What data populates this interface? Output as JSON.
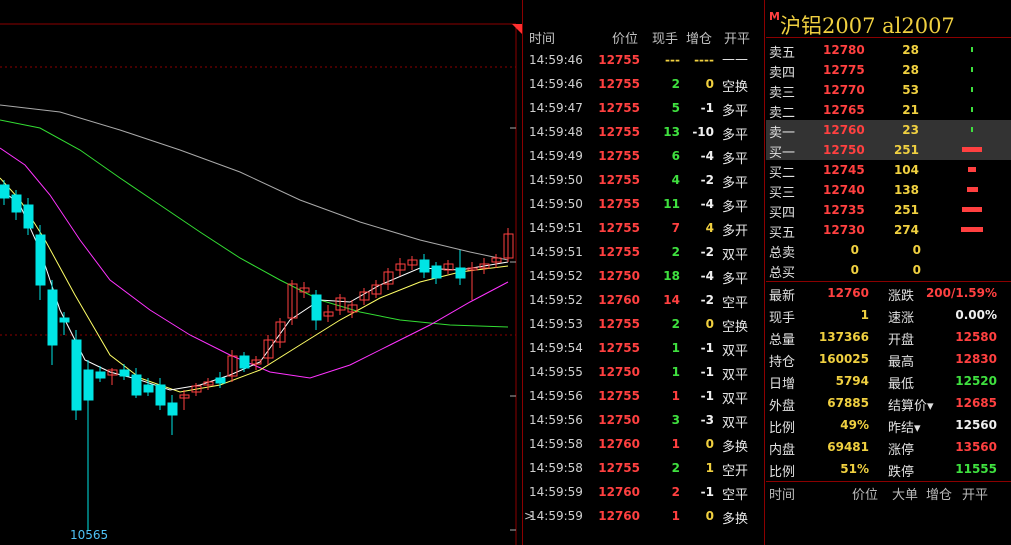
{
  "chart": {
    "low_label": "10565",
    "colors": {
      "up": "#ff4040",
      "down": "#00e5e5",
      "ma1": "#ffffff",
      "ma2": "#ffff66",
      "ma3": "#ff33ff",
      "ma4": "#33dd33",
      "ma5": "#aaaaaa"
    }
  },
  "trades": {
    "headers": {
      "time": "时间",
      "price": "价位",
      "vol": "现手",
      "oi": "增仓",
      "type": "开平"
    },
    "rows": [
      {
        "time": "14:59:46",
        "price": "12755",
        "vol": "---",
        "oi": "----",
        "type": "——"
      },
      {
        "time": "14:59:46",
        "price": "12755",
        "vol": "2",
        "oi": "0",
        "type": "空换"
      },
      {
        "time": "14:59:47",
        "price": "12755",
        "vol": "5",
        "oi": "-1",
        "type": "多平"
      },
      {
        "time": "14:59:48",
        "price": "12755",
        "vol": "13",
        "oi": "-10",
        "type": "多平"
      },
      {
        "time": "14:59:49",
        "price": "12755",
        "vol": "6",
        "oi": "-4",
        "type": "多平"
      },
      {
        "time": "14:59:50",
        "price": "12755",
        "vol": "4",
        "oi": "-2",
        "type": "多平"
      },
      {
        "time": "14:59:50",
        "price": "12755",
        "vol": "11",
        "oi": "-4",
        "type": "多平"
      },
      {
        "time": "14:59:51",
        "price": "12755",
        "vol": "7",
        "oi": "4",
        "type": "多开"
      },
      {
        "time": "14:59:51",
        "price": "12755",
        "vol": "2",
        "oi": "-2",
        "type": "双平"
      },
      {
        "time": "14:59:52",
        "price": "12750",
        "vol": "18",
        "oi": "-4",
        "type": "多平"
      },
      {
        "time": "14:59:52",
        "price": "12760",
        "vol": "14",
        "oi": "-2",
        "type": "空平"
      },
      {
        "time": "14:59:53",
        "price": "12755",
        "vol": "2",
        "oi": "0",
        "type": "空换"
      },
      {
        "time": "14:59:54",
        "price": "12755",
        "vol": "1",
        "oi": "-1",
        "type": "双平"
      },
      {
        "time": "14:59:55",
        "price": "12750",
        "vol": "1",
        "oi": "-1",
        "type": "双平"
      },
      {
        "time": "14:59:56",
        "price": "12755",
        "vol": "1",
        "oi": "-1",
        "type": "双平"
      },
      {
        "time": "14:59:56",
        "price": "12750",
        "vol": "3",
        "oi": "-3",
        "type": "双平"
      },
      {
        "time": "14:59:58",
        "price": "12760",
        "vol": "1",
        "oi": "0",
        "type": "多换"
      },
      {
        "time": "14:59:58",
        "price": "12755",
        "vol": "2",
        "oi": "1",
        "type": "空开"
      },
      {
        "time": "14:59:59",
        "price": "12760",
        "vol": "2",
        "oi": "-1",
        "type": "空平"
      },
      {
        "time": "14:59:59",
        "price": "12760",
        "vol": "1",
        "oi": "0",
        "type": "多换"
      }
    ],
    "vol_colors": [
      "yellow",
      "green",
      "green",
      "green",
      "green",
      "green",
      "green",
      "red",
      "green",
      "green",
      "red",
      "green",
      "green",
      "green",
      "red",
      "green",
      "red",
      "green",
      "red",
      "red"
    ],
    "oi_colors": [
      "yellow",
      "yellow",
      "white",
      "white",
      "white",
      "white",
      "white",
      "yellow",
      "white",
      "white",
      "white",
      "yellow",
      "white",
      "white",
      "white",
      "white",
      "yellow",
      "yellow",
      "white",
      "yellow"
    ],
    "cursor_mark": ">"
  },
  "quote": {
    "marker": "M",
    "title": "沪铝2007  al2007",
    "asks": [
      {
        "label": "卖五",
        "price": "12780",
        "qty": "28",
        "bar_fraction": 0.02
      },
      {
        "label": "卖四",
        "price": "12775",
        "qty": "28",
        "bar_fraction": 0.02
      },
      {
        "label": "卖三",
        "price": "12770",
        "qty": "53",
        "bar_fraction": 0.04
      },
      {
        "label": "卖二",
        "price": "12765",
        "qty": "21",
        "bar_fraction": 0.02
      },
      {
        "label": "卖一",
        "price": "12760",
        "qty": "23",
        "bar_fraction": 0.02
      }
    ],
    "bids": [
      {
        "label": "买一",
        "price": "12750",
        "qty": "251",
        "bar_fraction": 0.5
      },
      {
        "label": "买二",
        "price": "12745",
        "qty": "104",
        "bar_fraction": 0.2
      },
      {
        "label": "买三",
        "price": "12740",
        "qty": "138",
        "bar_fraction": 0.27
      },
      {
        "label": "买四",
        "price": "12735",
        "qty": "251",
        "bar_fraction": 0.5
      },
      {
        "label": "买五",
        "price": "12730",
        "qty": "274",
        "bar_fraction": 0.55
      }
    ],
    "totals": [
      {
        "label": "总卖",
        "v1": "0",
        "v2": "0"
      },
      {
        "label": "总买",
        "v1": "0",
        "v2": "0"
      }
    ],
    "stats": [
      {
        "l1": "最新",
        "v1": "12760",
        "c1": "red",
        "l2": "涨跌",
        "v2": "200/1.59%",
        "c2": "red"
      },
      {
        "l1": "现手",
        "v1": "1",
        "c1": "yellow",
        "l2": "速涨",
        "v2": "0.00%",
        "c2": "white"
      },
      {
        "l1": "总量",
        "v1": "137366",
        "c1": "yellow",
        "l2": "开盘",
        "v2": "12580",
        "c2": "red"
      },
      {
        "l1": "持仓",
        "v1": "160025",
        "c1": "yellow",
        "l2": "最高",
        "v2": "12830",
        "c2": "red"
      },
      {
        "l1": "日增",
        "v1": "5794",
        "c1": "yellow",
        "l2": "最低",
        "v2": "12520",
        "c2": "green"
      },
      {
        "l1": "外盘",
        "v1": "67885",
        "c1": "yellow",
        "l2": "结算价▾",
        "v2": "12685",
        "c2": "red"
      },
      {
        "l1": "比例",
        "v1": "49%",
        "c1": "yellow",
        "l2": "昨结▾",
        "v2": "12560",
        "c2": "white"
      },
      {
        "l1": "内盘",
        "v1": "69481",
        "c1": "yellow",
        "l2": "涨停",
        "v2": "13560",
        "c2": "red"
      },
      {
        "l1": "比例",
        "v1": "51%",
        "c1": "yellow",
        "l2": "跌停",
        "v2": "11555",
        "c2": "green"
      }
    ],
    "bottom_headers": {
      "time": "时间",
      "price": "价位",
      "big": "大单",
      "oi": "增仓",
      "type": "开平"
    }
  }
}
